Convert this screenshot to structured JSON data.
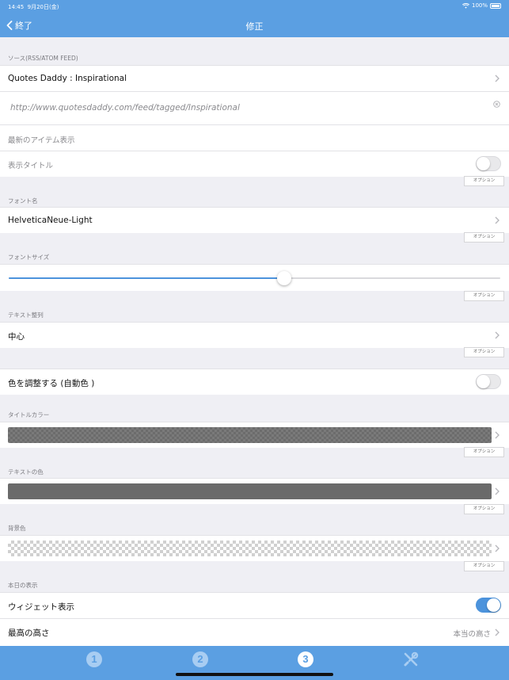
{
  "status_bar": {
    "time": "14:45",
    "date": "9月20日(金)",
    "battery": "100%"
  },
  "nav": {
    "back_label": "終了",
    "title": "修正"
  },
  "sections": {
    "source": {
      "header": "ソース(RSS/ATOM FEED)",
      "feed_name": "Quotes Daddy : Inspirational",
      "feed_url": "http://www.quotesdaddy.com/feed/tagged/Inspirational",
      "latest_item": "最新のアイテム表示",
      "show_title_label": "表示タイトル",
      "show_title_on": false
    },
    "font_name": {
      "header": "フォント名",
      "value": "HelveticaNeue-Light"
    },
    "font_size": {
      "header": "フォントサイズ",
      "slider_value": 0.56
    },
    "text_align": {
      "header": "テキスト整列",
      "value": "中心"
    },
    "auto_color": {
      "label": "色を調整する (自動色 )",
      "on": false
    },
    "title_color": {
      "header": "タイトルカラー"
    },
    "text_color": {
      "header": "テキストの色",
      "color": "#6a6a6a"
    },
    "background_color": {
      "header": "背景色"
    },
    "today": {
      "header": "本日の表示",
      "widget_label": "ウィジェット表示",
      "widget_on": true,
      "max_height_label": "最高の高さ",
      "max_height_value": "本当の高さ"
    }
  },
  "option_label": "オプション",
  "tabs": [
    {
      "label": "1",
      "active": false
    },
    {
      "label": "2",
      "active": false
    },
    {
      "label": "3",
      "active": true
    },
    {
      "icon": "tools-icon",
      "active": false
    }
  ],
  "colors": {
    "accent": "#5b9fe2",
    "toggle_on": "#4c93dc"
  }
}
